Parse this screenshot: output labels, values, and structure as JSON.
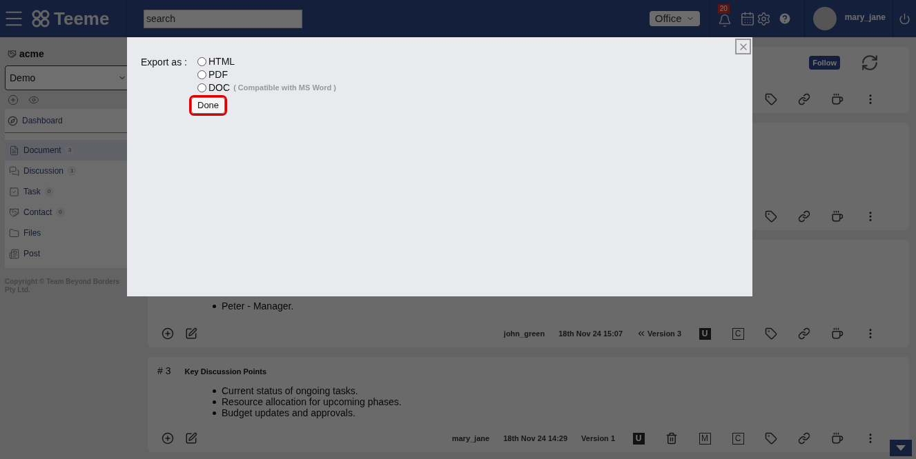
{
  "header": {
    "brand": "Teeme",
    "search": {
      "placeholder": "search"
    },
    "workspace": "Office",
    "notification_count": "20",
    "user": "mary_jane"
  },
  "sidebar": {
    "org": "acme",
    "space": "Demo",
    "dashboard": {
      "label": "Dashboard",
      "kind": "compass"
    },
    "items": [
      {
        "label": "Document",
        "count": "3",
        "kind": "document",
        "selected": true
      },
      {
        "label": "Discussion",
        "count": "1",
        "kind": "discussion",
        "selected": false
      },
      {
        "label": "Task",
        "count": "0",
        "kind": "task",
        "selected": false
      },
      {
        "label": "Contact",
        "count": "0",
        "kind": "contact",
        "selected": false
      },
      {
        "label": "Files",
        "kind": "files",
        "selected": false
      },
      {
        "label": "Post",
        "kind": "post",
        "selected": false
      }
    ],
    "copyright": "Copyright © Team Beyond Borders Pty Ltd."
  },
  "cards": [
    {
      "follow": "Follow",
      "tools": [
        {
          "kind": "tag"
        },
        {
          "kind": "link"
        },
        {
          "kind": "mug"
        },
        {
          "kind": "more"
        }
      ]
    },
    {
      "tools": [
        {
          "kind": "tag"
        },
        {
          "kind": "link"
        },
        {
          "kind": "mug"
        },
        {
          "kind": "more"
        }
      ]
    },
    {
      "bullets": [
        "Peter - Manager."
      ],
      "author": "john_green",
      "date": "18th Nov 24 15:07",
      "version": "Version 3",
      "has_previous": true,
      "tools": [
        {
          "kind": "solid_letter",
          "label": "U"
        },
        {
          "kind": "outline_letter",
          "label": "C"
        },
        {
          "kind": "tag"
        },
        {
          "kind": "link"
        },
        {
          "kind": "mug"
        },
        {
          "kind": "more"
        }
      ]
    },
    {
      "number": "# 3",
      "title": "Key Discussion Points",
      "bullets": [
        "Current status of ongoing tasks.",
        "Resource allocation for upcoming phases.",
        "Budget updates and approvals."
      ],
      "author": "mary_jane",
      "date": "18th Nov 24 14:29",
      "version": "Version 1",
      "has_previous": false,
      "tools": [
        {
          "kind": "solid_letter",
          "label": "U"
        },
        {
          "kind": "trash"
        },
        {
          "kind": "outline_letter",
          "label": "M"
        },
        {
          "kind": "outline_letter",
          "label": "C"
        },
        {
          "kind": "tag"
        },
        {
          "kind": "link"
        },
        {
          "kind": "mug"
        },
        {
          "kind": "more"
        }
      ]
    }
  ],
  "dialog": {
    "label": "Export as :",
    "options": [
      {
        "label": "HTML",
        "selected": false
      },
      {
        "label": "PDF",
        "selected": false
      },
      {
        "label": "DOC",
        "note": "( Compatible with MS Word )",
        "selected": false
      }
    ],
    "done": "Done",
    "done_focused": true
  }
}
